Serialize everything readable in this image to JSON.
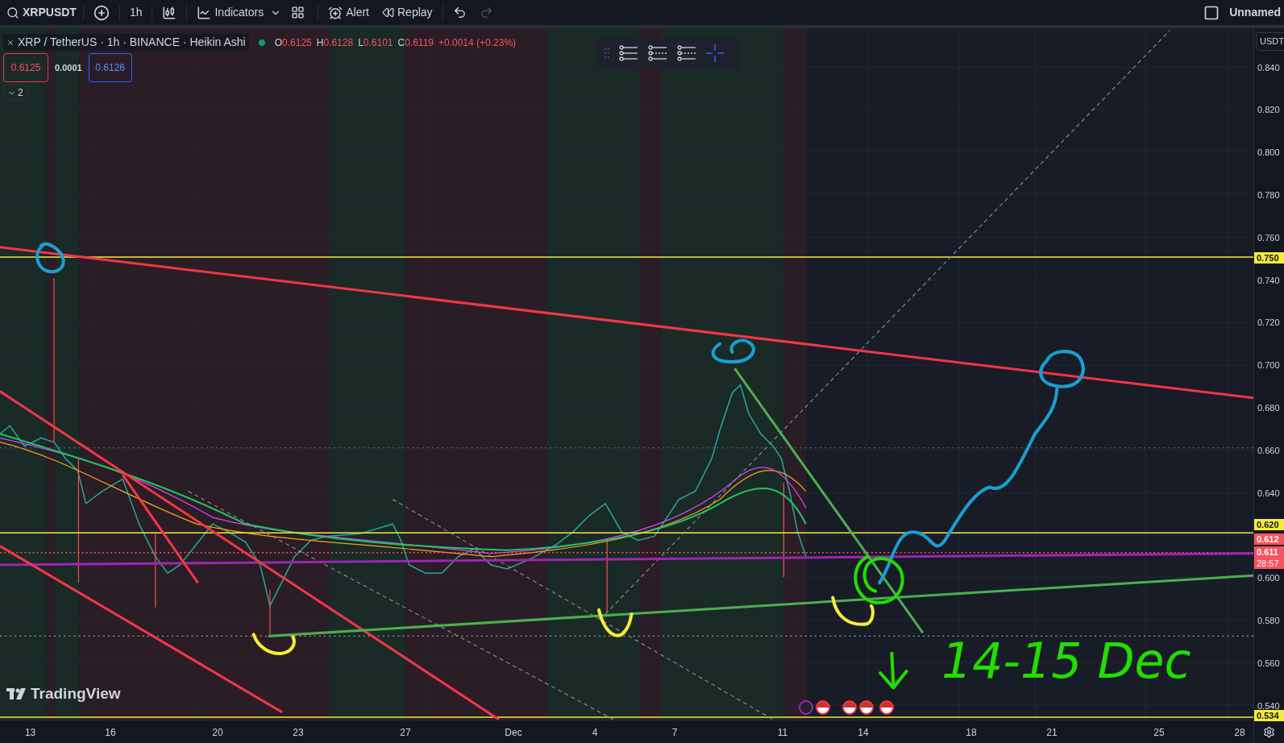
{
  "toolbar": {
    "symbol": "XRPUSDT",
    "interval": "1h",
    "indicators": "Indicators",
    "alert": "Alert",
    "replay": "Replay",
    "redo": {
      "disabled": true
    },
    "layout_name": "Unnamed"
  },
  "legend": {
    "title": "XRP / TetherUS · 1h · BINANCE · Heikin Ashi",
    "market_open": true,
    "ohlc": [
      {
        "label": "O",
        "value": "0.6125"
      },
      {
        "label": "H",
        "value": "0.6128"
      },
      {
        "label": "L",
        "value": "0.6101"
      },
      {
        "label": "C",
        "value": "0.6119"
      }
    ],
    "change": "+0.0014 (+0.23%)",
    "sell": "0.6125",
    "spread": "0.0001",
    "buy": "0.6126",
    "collapsed_count": "2"
  },
  "price_axis": {
    "currency": "USDT",
    "ticks_upper": [
      "0.840",
      "0.820",
      "0.800",
      "0.780",
      "0.760",
      "0.740",
      "0.720",
      "0.700",
      "0.680",
      "0.660",
      "0.640"
    ],
    "ticks_lower": [
      "0.600",
      "0.580",
      "0.560",
      "0.540"
    ],
    "markers": [
      {
        "label": "0.750",
        "kind": "line",
        "color": "#f5eb3b"
      },
      {
        "label": "0.620",
        "kind": "line",
        "color": "#f5eb3b"
      },
      {
        "label": "0.612",
        "kind": "price",
        "color": "#f7525f"
      },
      {
        "label": "0.611",
        "sub": "28:57",
        "kind": "price",
        "color": "#f7525f"
      },
      {
        "label": "0.534",
        "kind": "line",
        "color": "#f5eb3b"
      }
    ]
  },
  "time_axis": [
    "13",
    "16",
    "20",
    "23",
    "27",
    "Dec",
    "4",
    "7",
    "11",
    "14",
    "18",
    "21",
    "25",
    "28"
  ],
  "annotation": "14-15 Dec",
  "watermark": "TradingView"
}
